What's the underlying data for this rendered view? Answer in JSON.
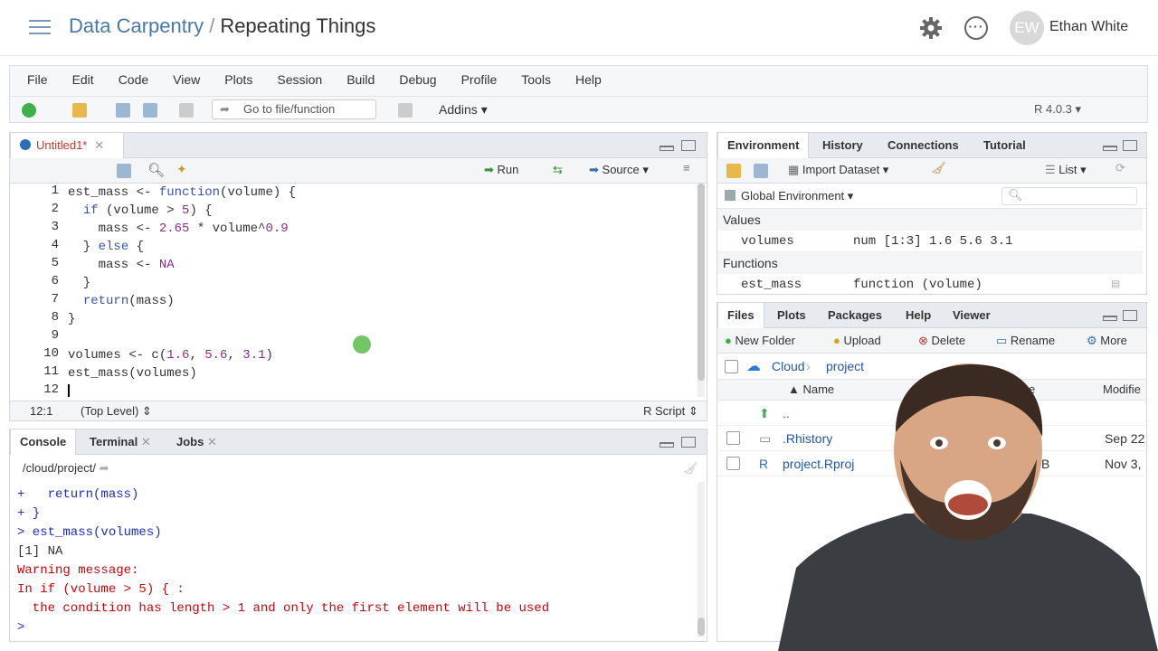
{
  "header": {
    "crumb_parent": "Data Carpentry",
    "crumb_sep": "/",
    "crumb_current": "Repeating Things",
    "avatar_initials": "EW",
    "user_name": "Ethan White"
  },
  "menu": [
    "File",
    "Edit",
    "Code",
    "View",
    "Plots",
    "Session",
    "Build",
    "Debug",
    "Profile",
    "Tools",
    "Help"
  ],
  "toolbar": {
    "goto_placeholder": "Go to file/function",
    "addins": "Addins",
    "r_version": "R 4.0.3"
  },
  "editor": {
    "tab": "Untitled1*",
    "run": "Run",
    "source": "Source",
    "line_numbers": [
      "1",
      "2",
      "3",
      "4",
      "5",
      "6",
      "7",
      "8",
      "9",
      "10",
      "11",
      "12"
    ],
    "status_pos": "12:1",
    "status_scope": "(Top Level)",
    "status_type": "R Script"
  },
  "console": {
    "tabs": [
      "Console",
      "Terminal",
      "Jobs"
    ],
    "path": "/cloud/project/",
    "lines": [
      "+   return(mass)",
      "+ }",
      "> est_mass(volumes)",
      "[1] NA",
      "Warning message:",
      "In if (volume > 5) { :",
      "  the condition has length > 1 and only the first element will be used",
      ">"
    ]
  },
  "env": {
    "tabs": [
      "Environment",
      "History",
      "Connections",
      "Tutorial"
    ],
    "import": "Import Dataset",
    "list": "List",
    "scope": "Global Environment",
    "values_header": "Values",
    "functions_header": "Functions",
    "values": [
      {
        "name": "volumes",
        "value": "num [1:3] 1.6 5.6 3.1"
      }
    ],
    "functions": [
      {
        "name": "est_mass",
        "value": "function (volume)"
      }
    ]
  },
  "files": {
    "tabs": [
      "Files",
      "Plots",
      "Packages",
      "Help",
      "Viewer"
    ],
    "actions": [
      "New Folder",
      "Upload",
      "Delete",
      "Rename",
      "More"
    ],
    "crumb_root": "Cloud",
    "crumb_sub": "project",
    "col_name": "Name",
    "col_size": "Size",
    "col_modified": "Modifie",
    "rows": [
      {
        "name": "..",
        "size": "",
        "modified": ""
      },
      {
        "name": ".Rhistory",
        "size": "",
        "modified": "Sep 22"
      },
      {
        "name": "project.Rproj",
        "size": "B",
        "modified": "Nov 3,"
      }
    ]
  }
}
